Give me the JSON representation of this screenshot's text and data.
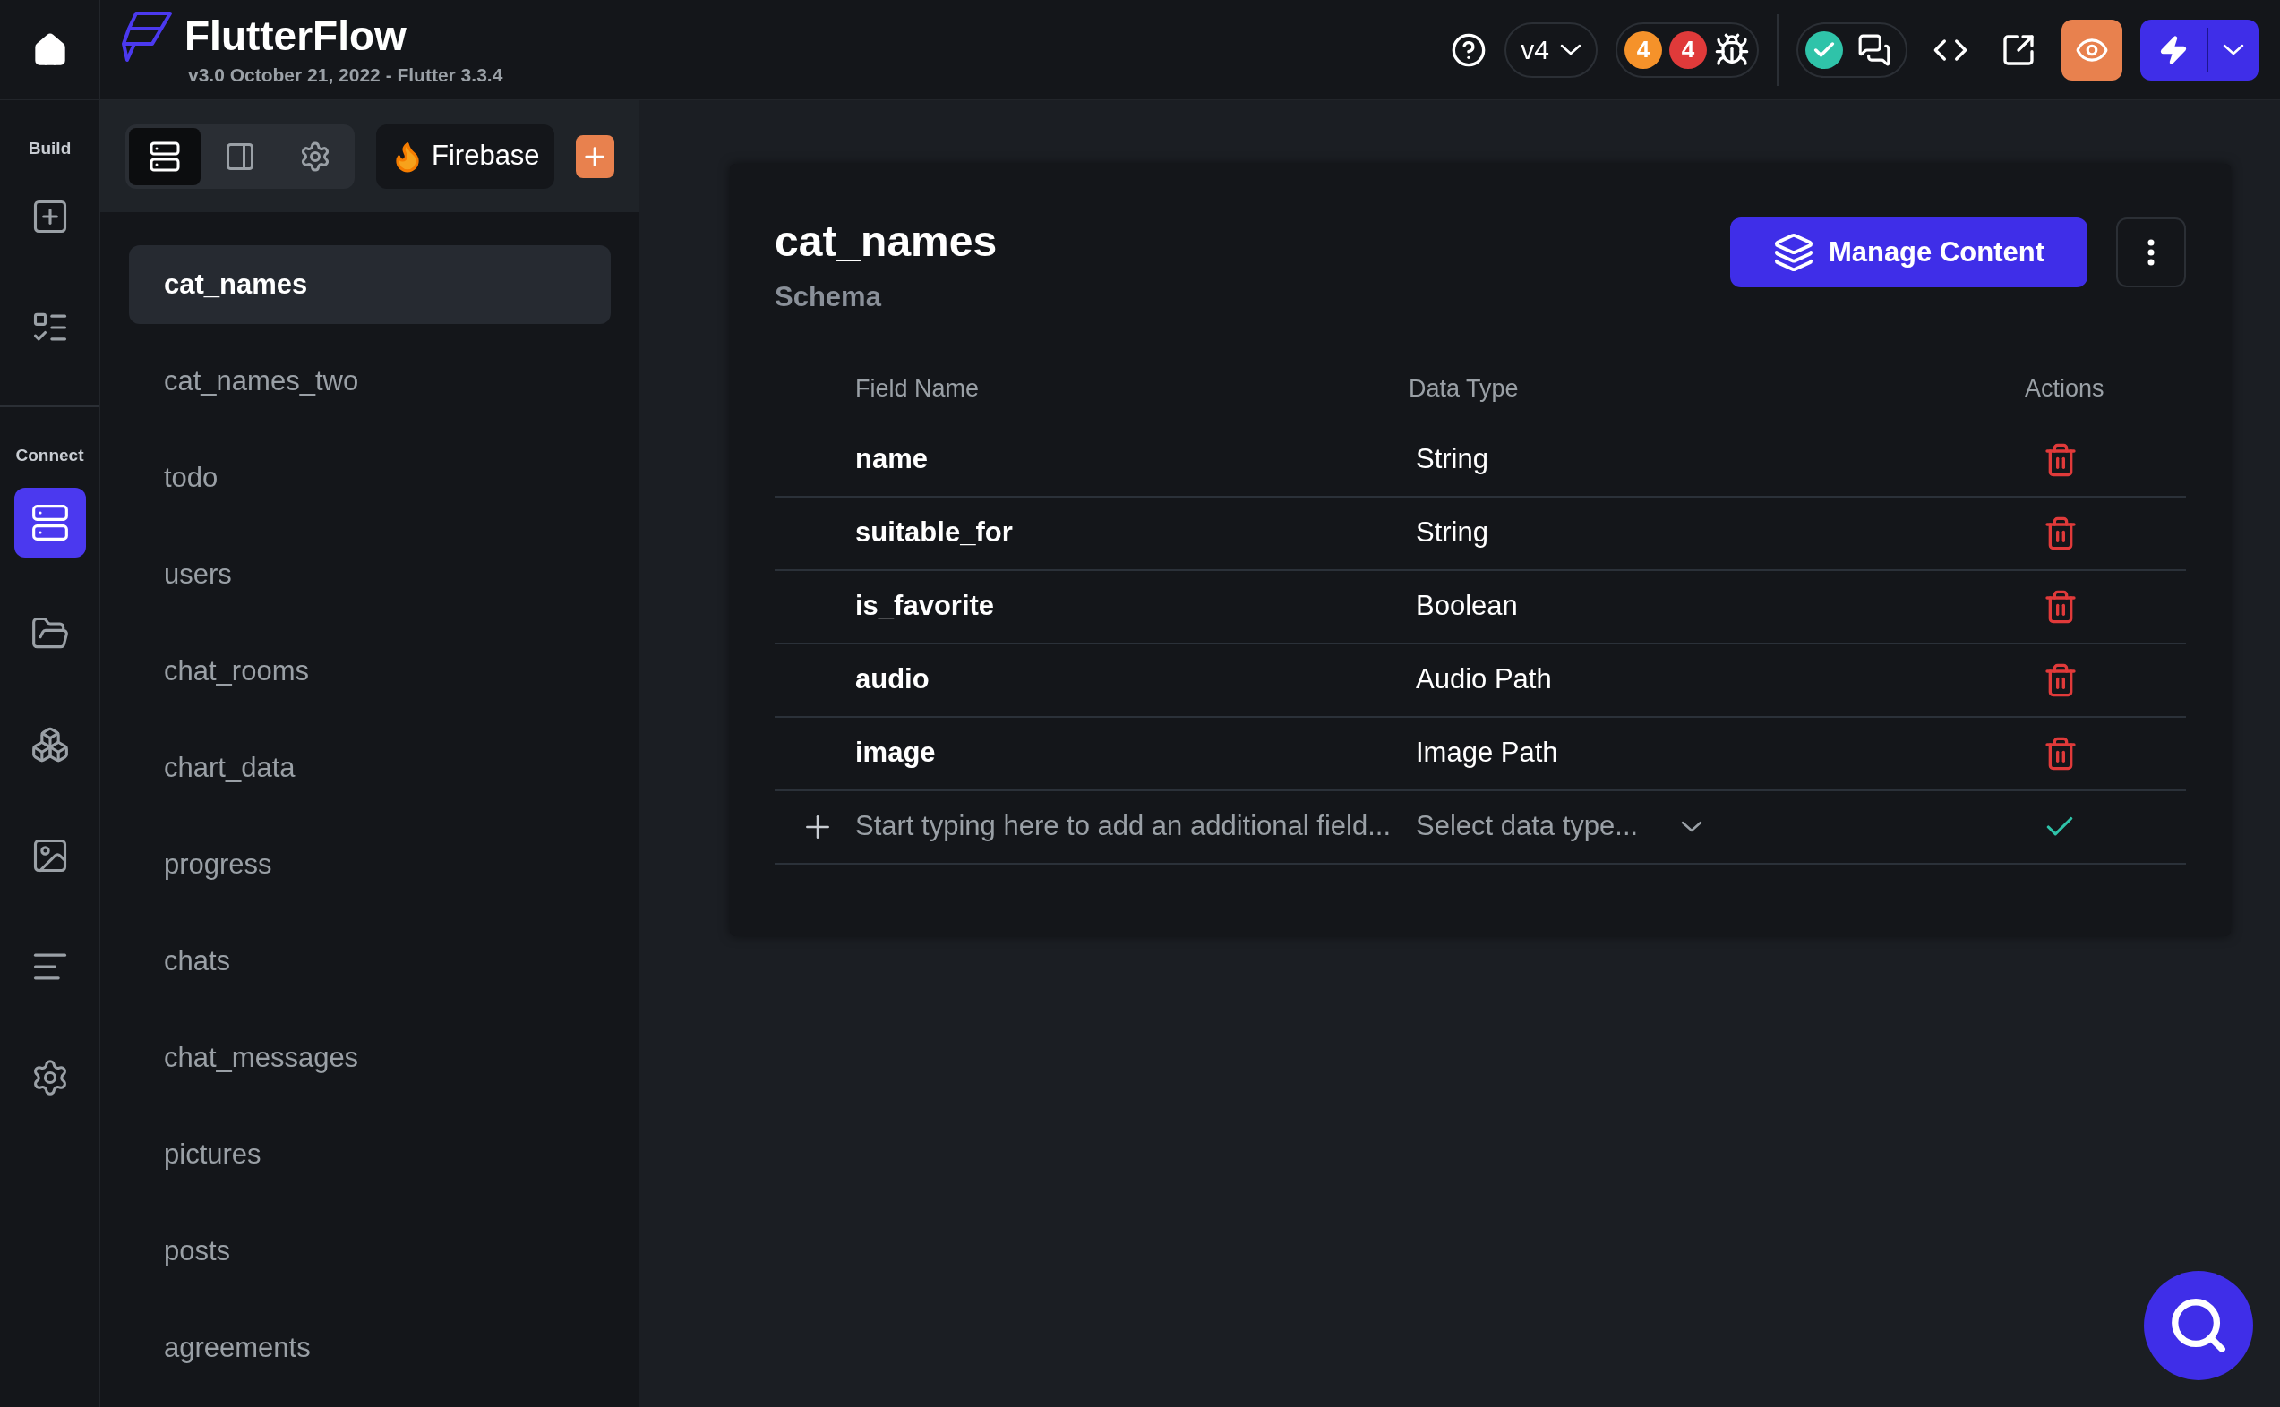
{
  "app": {
    "name": "FlutterFlow",
    "version": "v3.0 October 21, 2022 - Flutter 3.3.4"
  },
  "toolbar": {
    "version": "v4",
    "warnings": "4",
    "errors": "4"
  },
  "rail": {
    "home": {
      "kind": "home"
    },
    "sections": [
      {
        "label": "Build",
        "items": [
          {
            "kind": "add-page",
            "selected": false
          },
          {
            "kind": "list",
            "selected": false
          }
        ]
      },
      {
        "label": "Connect",
        "items": [
          {
            "kind": "database",
            "selected": true
          },
          {
            "kind": "folder",
            "selected": false
          },
          {
            "kind": "nodes",
            "selected": false
          },
          {
            "kind": "media",
            "selected": false
          },
          {
            "kind": "text",
            "selected": false
          },
          {
            "kind": "settings",
            "selected": false
          }
        ]
      }
    ]
  },
  "sidebar": {
    "tabs": [
      {
        "kind": "collections",
        "selected": true
      },
      {
        "kind": "panel",
        "selected": false
      },
      {
        "kind": "settings",
        "selected": false
      }
    ],
    "backend": "Firebase",
    "collections": [
      {
        "label": "cat_names",
        "selected": true
      },
      {
        "label": "cat_names_two",
        "selected": false
      },
      {
        "label": "todo",
        "selected": false
      },
      {
        "label": "users",
        "selected": false
      },
      {
        "label": "chat_rooms",
        "selected": false
      },
      {
        "label": "chart_data",
        "selected": false
      },
      {
        "label": "progress",
        "selected": false
      },
      {
        "label": "chats",
        "selected": false
      },
      {
        "label": "chat_messages",
        "selected": false
      },
      {
        "label": "pictures",
        "selected": false
      },
      {
        "label": "posts",
        "selected": false
      },
      {
        "label": "agreements",
        "selected": false
      }
    ]
  },
  "content": {
    "title": "cat_names",
    "subtitle": "Schema",
    "manage_button": "Manage Content",
    "columns": [
      "Field Name",
      "Data Type",
      "Actions"
    ],
    "fields": [
      {
        "name": "name",
        "type": "String"
      },
      {
        "name": "suitable_for",
        "type": "String"
      },
      {
        "name": "is_favorite",
        "type": "Boolean"
      },
      {
        "name": "audio",
        "type": "Audio Path"
      },
      {
        "name": "image",
        "type": "Image Path"
      }
    ],
    "new_field": {
      "placeholder": "Start typing here to add an additional field...",
      "type_placeholder": "Select data type..."
    }
  }
}
